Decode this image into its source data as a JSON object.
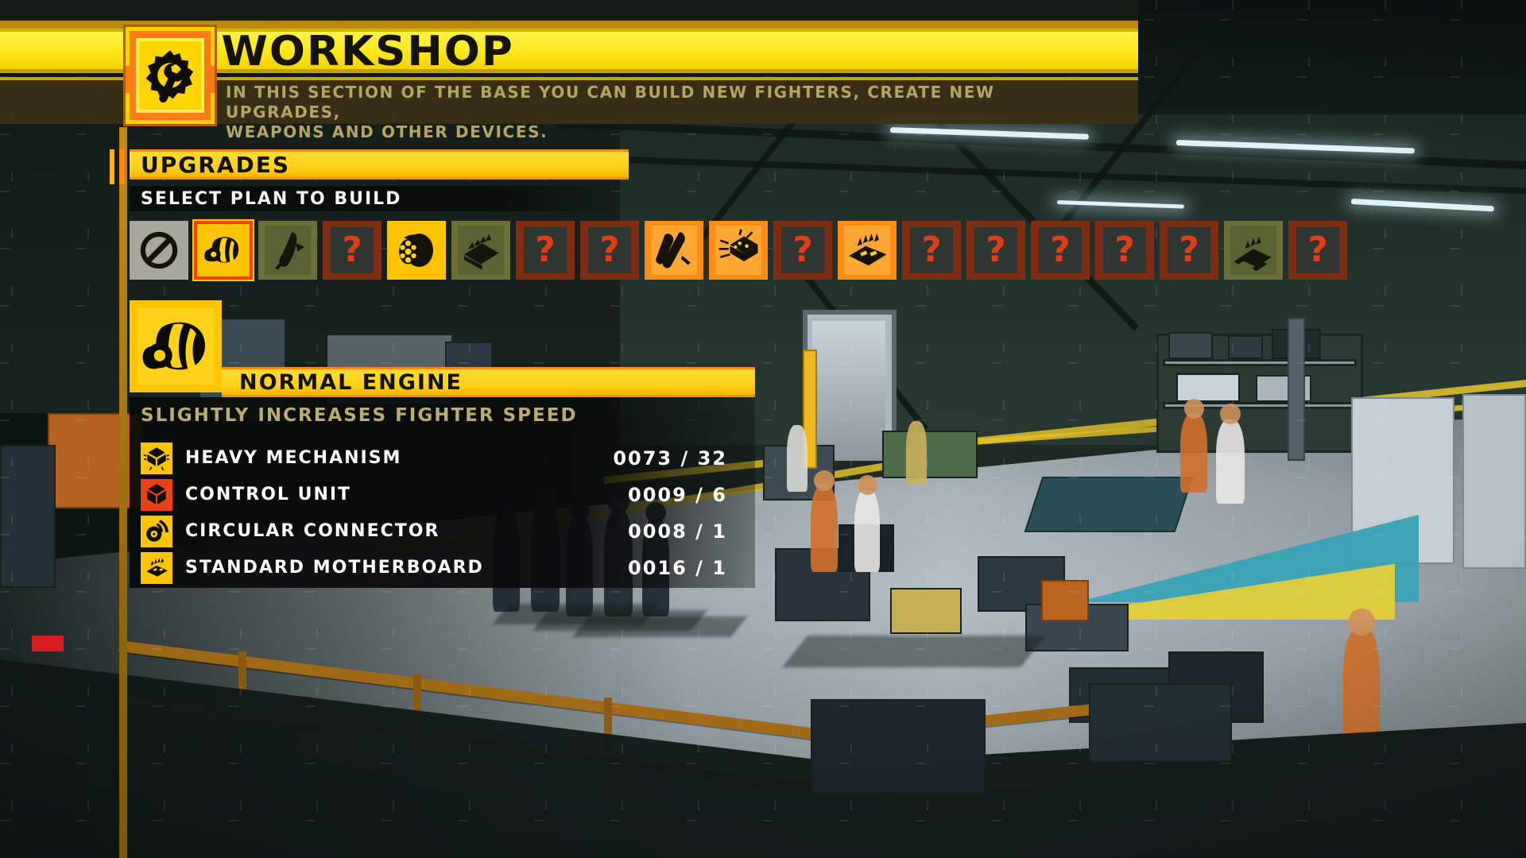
{
  "header": {
    "title": "WORKSHOP",
    "description_line1": "IN THIS SECTION OF THE BASE YOU CAN BUILD NEW FIGHTERS, CREATE NEW UPGRADES,",
    "description_line2": "WEAPONS AND OTHER DEVICES.",
    "icon": "gear-wrench-icon"
  },
  "section": {
    "title": "UPGRADES",
    "subtitle": "SELECT PLAN TO BUILD"
  },
  "plans": [
    {
      "index": 0,
      "icon": "no-entry-icon",
      "state": "disabled",
      "selected": false
    },
    {
      "index": 1,
      "icon": "engine-icon",
      "state": "available",
      "selected": true
    },
    {
      "index": 2,
      "icon": "booster-icon",
      "state": "researched",
      "selected": false
    },
    {
      "index": 3,
      "icon": "unknown-icon",
      "state": "locked",
      "selected": false
    },
    {
      "index": 4,
      "icon": "turbine-icon",
      "state": "available",
      "selected": false
    },
    {
      "index": 5,
      "icon": "armor-plate-icon",
      "state": "researched",
      "selected": false
    },
    {
      "index": 6,
      "icon": "unknown-icon",
      "state": "locked",
      "selected": false
    },
    {
      "index": 7,
      "icon": "unknown-icon",
      "state": "locked",
      "selected": false
    },
    {
      "index": 8,
      "icon": "missile-icon",
      "state": "available",
      "selected": false
    },
    {
      "index": 9,
      "icon": "chip-icon",
      "state": "available",
      "selected": false
    },
    {
      "index": 10,
      "icon": "unknown-icon",
      "state": "locked",
      "selected": false
    },
    {
      "index": 11,
      "icon": "circuit-board-icon",
      "state": "available",
      "selected": false
    },
    {
      "index": 12,
      "icon": "unknown-icon",
      "state": "locked",
      "selected": false
    },
    {
      "index": 13,
      "icon": "unknown-icon",
      "state": "locked",
      "selected": false
    },
    {
      "index": 14,
      "icon": "unknown-icon",
      "state": "locked",
      "selected": false
    },
    {
      "index": 15,
      "icon": "unknown-icon",
      "state": "locked",
      "selected": false
    },
    {
      "index": 16,
      "icon": "unknown-icon",
      "state": "locked",
      "selected": false
    },
    {
      "index": 17,
      "icon": "circuit-module-icon",
      "state": "researched",
      "selected": false
    },
    {
      "index": 18,
      "icon": "unknown-icon",
      "state": "locked",
      "selected": false
    }
  ],
  "detail": {
    "icon": "engine-icon",
    "title": "NORMAL ENGINE",
    "description": "SLIGHTLY INCREASES FIGHTER SPEED",
    "materials": [
      {
        "icon": "heavy-mechanism-icon",
        "name": "HEAVY MECHANISM",
        "have": "0073",
        "sep": "/",
        "need": "32"
      },
      {
        "icon": "control-unit-icon",
        "name": "CONTROL UNIT",
        "have": "0009",
        "sep": "/",
        "need": "6"
      },
      {
        "icon": "circular-connector-icon",
        "name": "CIRCULAR CONNECTOR",
        "have": "0008",
        "sep": "/",
        "need": "1"
      },
      {
        "icon": "standard-motherboard-icon",
        "name": "STANDARD MOTHERBOARD",
        "have": "0016",
        "sep": "/",
        "need": "1"
      }
    ]
  },
  "colors": {
    "accent_yellow": "#ffd21a",
    "accent_orange": "#ff8c12",
    "locked_red": "#7e2c12",
    "question_red": "#e23c17",
    "olive": "#6a7038",
    "panel_dark": "#080b0a"
  }
}
